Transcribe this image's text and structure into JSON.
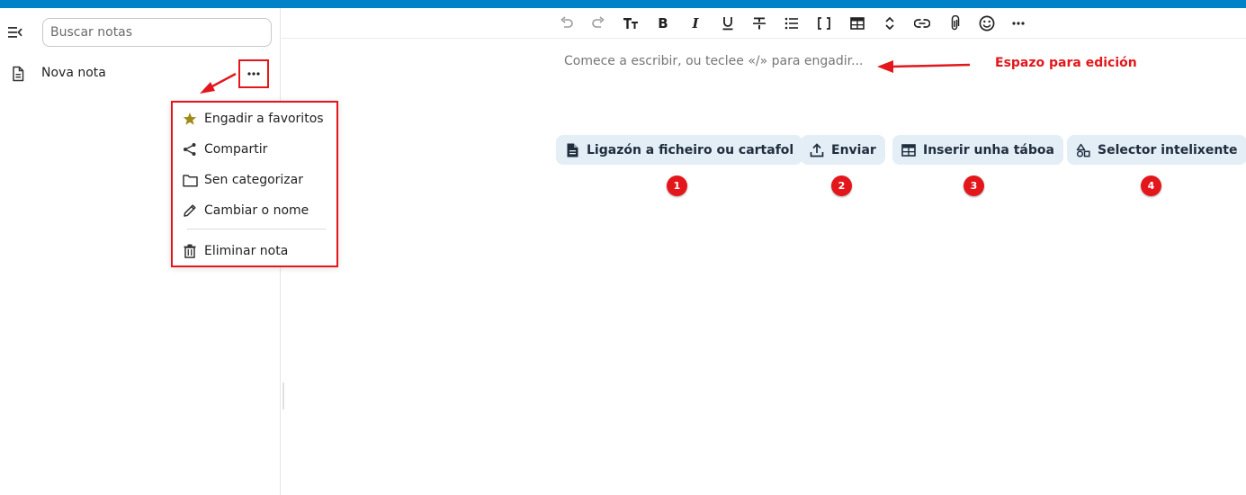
{
  "sidebar": {
    "search": {
      "placeholder": "Buscar notas",
      "value": ""
    },
    "notes": [
      {
        "title": "Nova nota"
      }
    ],
    "menu": {
      "items": [
        {
          "label": "Engadir a favoritos",
          "icon": "star-icon"
        },
        {
          "label": "Compartir",
          "icon": "share-icon"
        },
        {
          "label": "Sen categorizar",
          "icon": "folder-icon"
        },
        {
          "label": "Cambiar o nome",
          "icon": "pencil-icon"
        },
        {
          "label": "Eliminar nota",
          "icon": "trash-icon"
        }
      ]
    }
  },
  "toolbar": {
    "buttons": [
      "undo-icon",
      "redo-icon",
      "heading-icon",
      "bold-icon",
      "italic-icon",
      "underline-icon",
      "strikethrough-icon",
      "bullet-list-icon",
      "code-icon",
      "table-icon",
      "expand-icon",
      "link-icon",
      "attachment-icon",
      "emoji-icon",
      "more-icon"
    ]
  },
  "editor": {
    "placeholder": "Comece a escribir, ou teclee «/» para engadir..."
  },
  "actions": [
    {
      "label": "Ligazón a ficheiro ou cartafol",
      "icon": "file-icon",
      "badge": "1"
    },
    {
      "label": "Enviar",
      "icon": "upload-icon",
      "badge": "2"
    },
    {
      "label": "Inserir unha táboa",
      "icon": "table-icon",
      "badge": "3"
    },
    {
      "label": "Selector intelixente",
      "icon": "shapes-icon",
      "badge": "4"
    }
  ],
  "annotation": {
    "label": "Espazo para edición"
  },
  "colors": {
    "accent": "#0082c9",
    "annotation": "#e3171b",
    "button_bg": "#e3eef7",
    "star": "#a08a14"
  }
}
